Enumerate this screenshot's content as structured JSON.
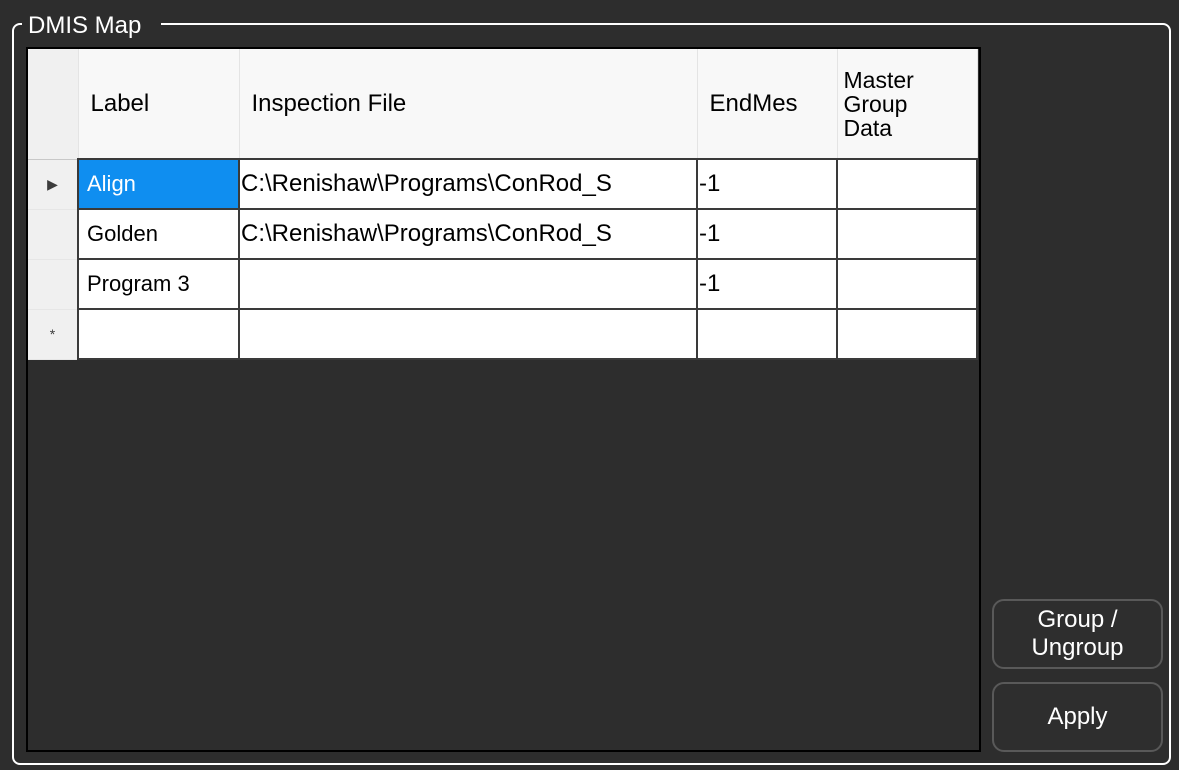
{
  "groupbox": {
    "title": "DMIS Map"
  },
  "grid": {
    "columns": [
      {
        "key": "label",
        "title": "Label"
      },
      {
        "key": "inspection_file",
        "title": "Inspection File"
      },
      {
        "key": "endmes",
        "title": "EndMes"
      },
      {
        "key": "master_group_data",
        "title": "Master\nGroup\nData"
      }
    ],
    "row_markers": {
      "current": "▶",
      "new": "*"
    },
    "rows": [
      {
        "label": "Align",
        "inspection_file": "C:\\Renishaw\\Programs\\ConRod_S",
        "endmes": "-1",
        "master_group_data": ""
      },
      {
        "label": "Golden",
        "inspection_file": "C:\\Renishaw\\Programs\\ConRod_S",
        "endmes": "-1",
        "master_group_data": ""
      },
      {
        "label": "Program 3",
        "inspection_file": "",
        "endmes": "-1",
        "master_group_data": ""
      }
    ]
  },
  "buttons": {
    "group_ungroup": "Group /\nUngroup",
    "apply": "Apply"
  },
  "colors": {
    "selection": "#0f8ef0",
    "background": "#2d2d2d"
  }
}
